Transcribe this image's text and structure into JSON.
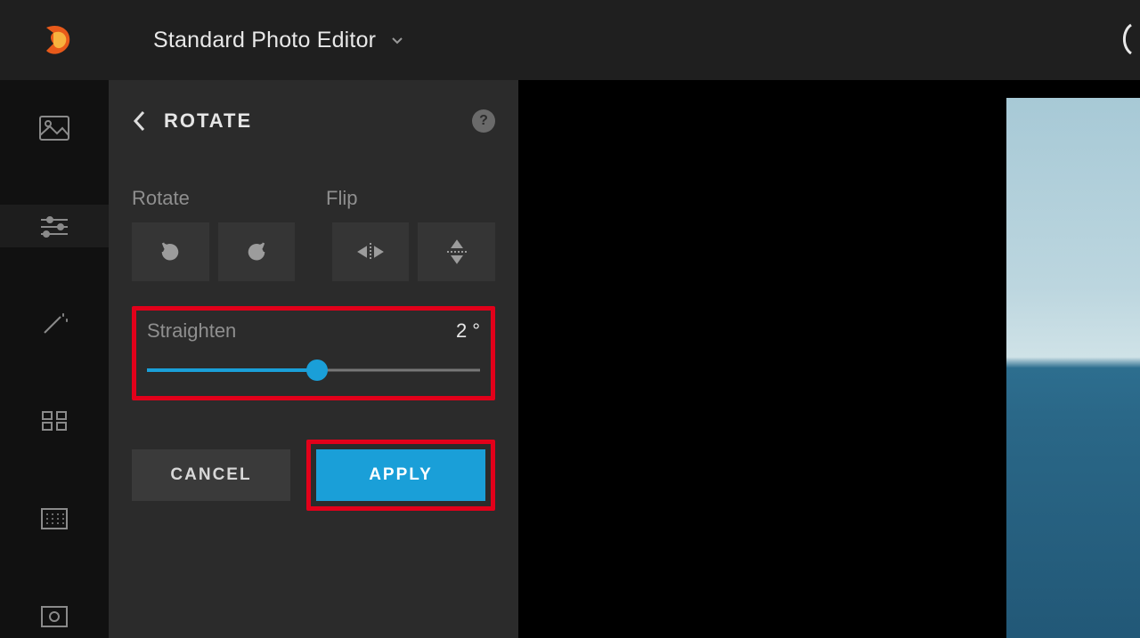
{
  "header": {
    "app_title": "Standard Photo Editor"
  },
  "panel": {
    "title": "ROTATE",
    "rotate_label": "Rotate",
    "flip_label": "Flip",
    "straighten_label": "Straighten",
    "straighten_value": "2",
    "straighten_unit": "°",
    "cancel": "CANCEL",
    "apply": "APPLY",
    "help": "?"
  }
}
